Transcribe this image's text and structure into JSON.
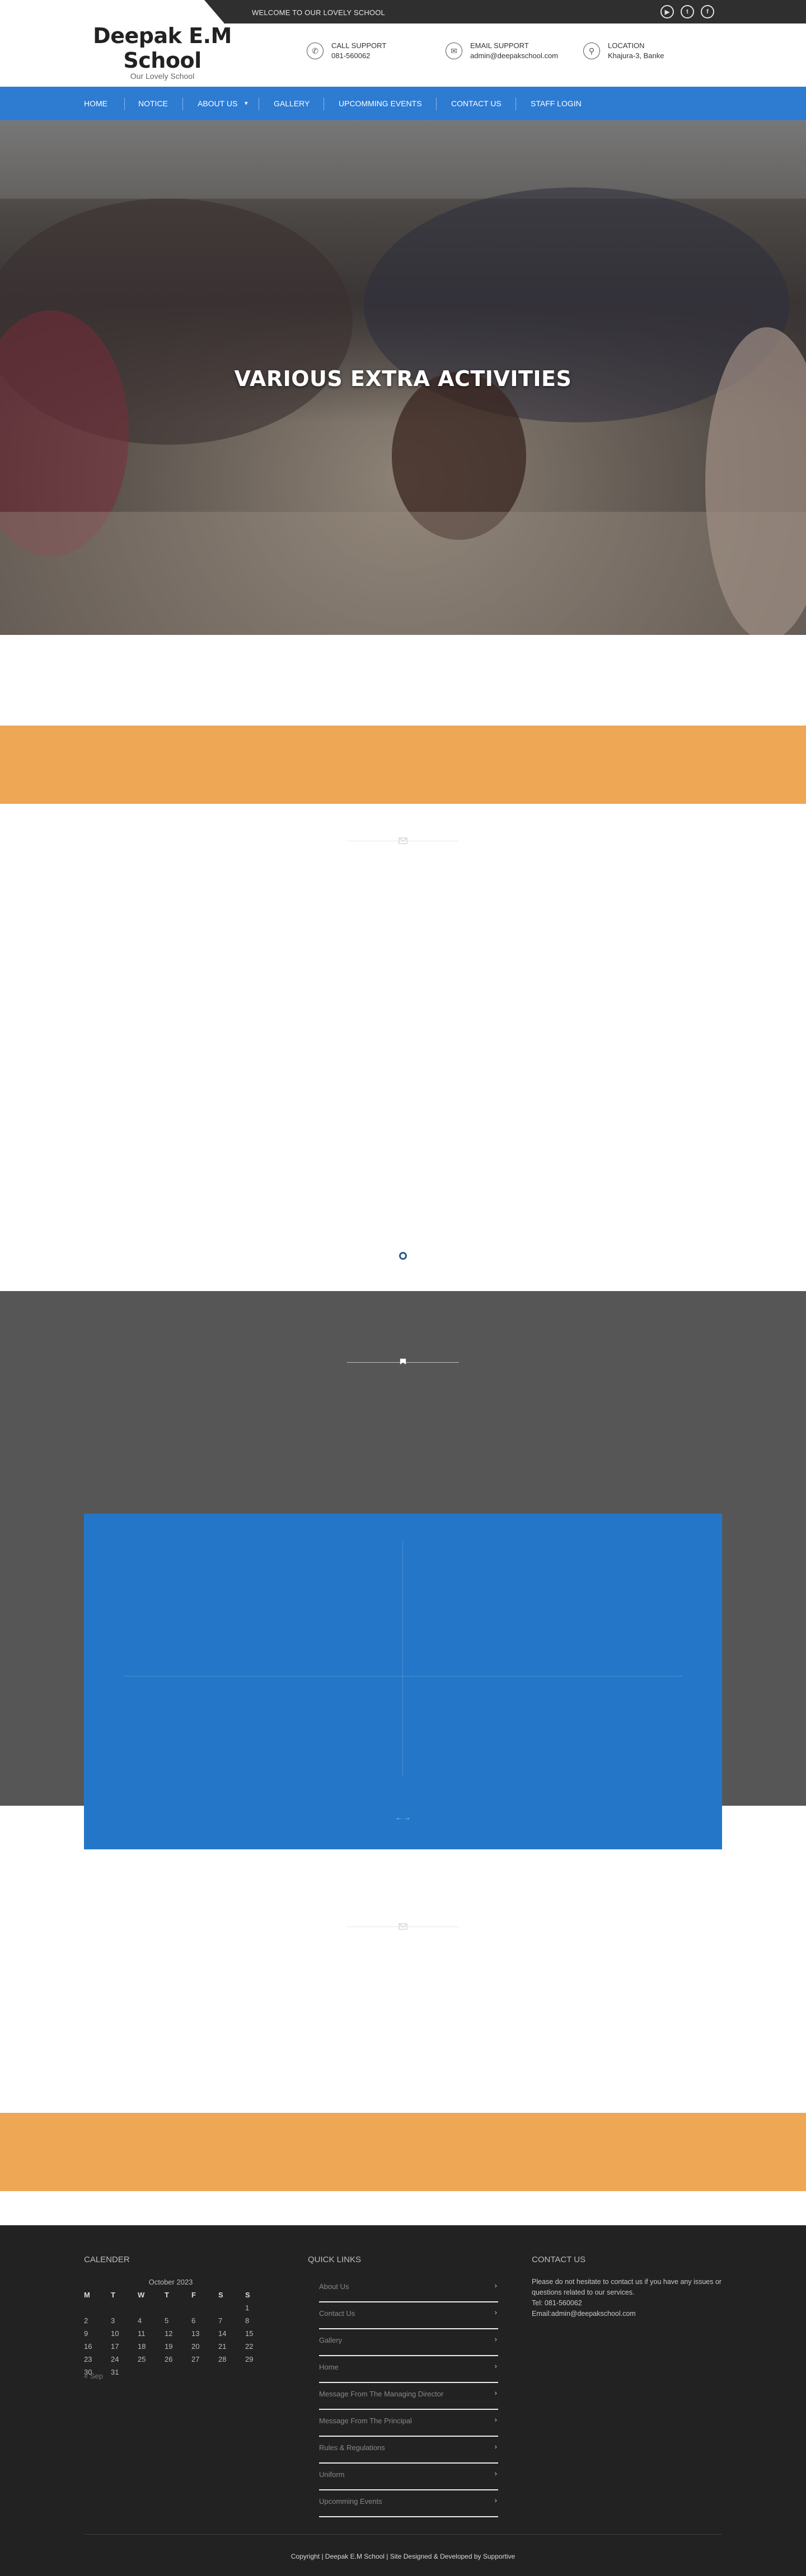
{
  "topbar": {
    "welcome": "WELCOME TO OUR LOVELY SCHOOL",
    "social": [
      {
        "icon": "youtube-icon",
        "glyph": "▶"
      },
      {
        "icon": "twitter-icon",
        "glyph": "t"
      },
      {
        "icon": "facebook-icon",
        "glyph": "f"
      }
    ]
  },
  "header": {
    "school_name": "Deepak E.M School",
    "tagline": "Our Lovely School",
    "contacts": [
      {
        "icon": "phone-icon",
        "label": "CALL SUPPORT",
        "value": "081-560062"
      },
      {
        "icon": "email-icon",
        "label": "EMAIL SUPPORT",
        "value": "admin@deepakschool.com"
      },
      {
        "icon": "location-icon",
        "label": "LOCATION",
        "value": "Khajura-3, Banke"
      }
    ]
  },
  "nav": {
    "items": [
      "HOME",
      "NOTICE",
      "ABOUT US",
      "GALLERY",
      "UPCOMMING EVENTS",
      "CONTACT US",
      "STAFF LOGIN"
    ],
    "dropdown_glyph": "▾"
  },
  "hero": {
    "title": "VARIOUS EXTRA ACTIVITIES"
  },
  "blue_box": {
    "pager": "← →"
  },
  "footer": {
    "calendar": {
      "heading": "CALENDER",
      "caption": "October 2023",
      "weekdays": [
        "M",
        "T",
        "W",
        "T",
        "F",
        "S",
        "S"
      ],
      "weeks": [
        [
          "",
          "",
          "",
          "",
          "",
          "",
          "1"
        ],
        [
          "2",
          "3",
          "4",
          "5",
          "6",
          "7",
          "8"
        ],
        [
          "9",
          "10",
          "11",
          "12",
          "13",
          "14",
          "15"
        ],
        [
          "16",
          "17",
          "18",
          "19",
          "20",
          "21",
          "22"
        ],
        [
          "23",
          "24",
          "25",
          "26",
          "27",
          "28",
          "29"
        ],
        [
          "30",
          "31",
          "",
          "",
          "",
          "",
          ""
        ]
      ],
      "prev_link": "« Sep"
    },
    "quick_links": {
      "heading": "QUICK LINKS",
      "items": [
        "About Us",
        "Contact Us",
        "Gallery",
        "Home",
        "Message From The Managing Director",
        "Message From The Principal",
        "Rules & Regulations",
        "Uniform",
        "Upcomming Events"
      ],
      "arrow": "›"
    },
    "contact": {
      "heading": "CONTACT US",
      "text": "Please do not hesitate to contact us if you have any issues or questions related to our services.",
      "tel": "Tel: 081-560062",
      "email": "Email:admin@deepakschool.com"
    },
    "copyright": "Copyright | Deepak E.M School | Site Designed & Developed by Supportive"
  },
  "colors": {
    "nav_blue": "#2e7bd2",
    "orange_band": "#eda755",
    "gray_section": "#565656",
    "footer_bg": "#222222",
    "topbar_dark": "#2f2f2f"
  }
}
